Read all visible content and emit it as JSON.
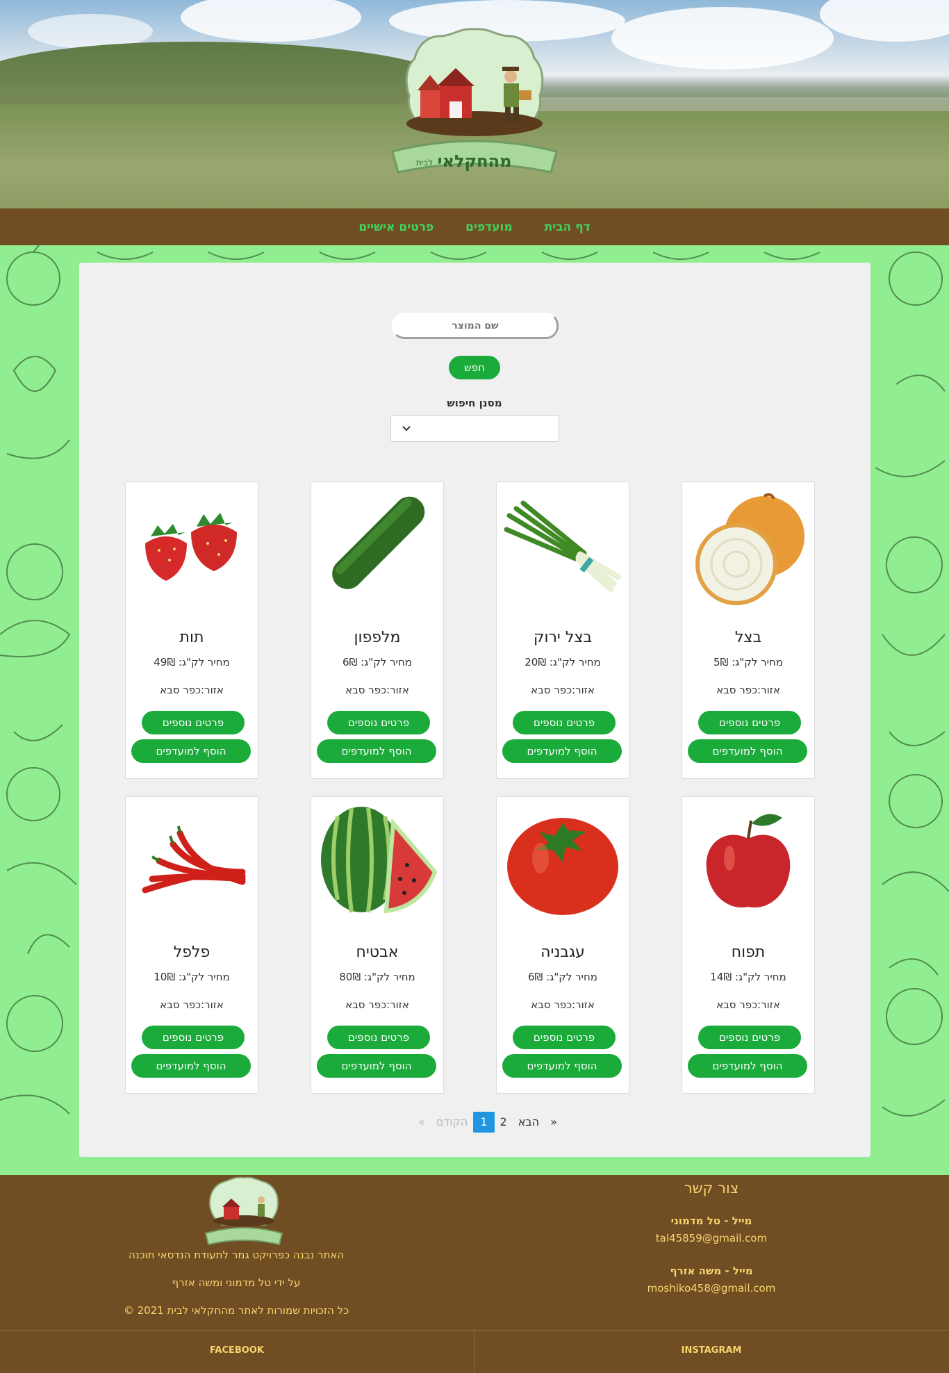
{
  "nav": {
    "home": "דף הבית",
    "favorites": "מועדפים",
    "personal": "פרטים אישיים"
  },
  "logo": {
    "text_main": "מהחקלאי",
    "text_small": "לבית"
  },
  "search": {
    "placeholder": "שם המוצר",
    "button": "חפש",
    "filter_label": "מסנן חיפוש",
    "filter_value": ""
  },
  "products": [
    {
      "name": "בצל",
      "price": "מחיר לק\"ג: 5₪",
      "area": "אזור:כפר סבא",
      "more": "פרטים נוספים",
      "fav": "הוסף למועדפים",
      "icon": "onion-image"
    },
    {
      "name": "בצל ירוק",
      "price": "מחיר לק\"ג: 20₪",
      "area": "אזור:כפר סבא",
      "more": "פרטים נוספים",
      "fav": "הוסף למועדפים",
      "icon": "green-onion-image"
    },
    {
      "name": "מלפפון",
      "price": "מחיר לק\"ג: 6₪",
      "area": "אזור:כפר סבא",
      "more": "פרטים נוספים",
      "fav": "הוסף למועדפים",
      "icon": "cucumber-image"
    },
    {
      "name": "תות",
      "price": "מחיר לק\"ג: 49₪",
      "area": "אזור:כפר סבא",
      "more": "פרטים נוספים",
      "fav": "הוסף למועדפים",
      "icon": "strawberry-image"
    },
    {
      "name": "תפוח",
      "price": "מחיר לק\"ג: 14₪",
      "area": "אזור:כפר סבא",
      "more": "פרטים נוספים",
      "fav": "הוסף למועדפים",
      "icon": "apple-image"
    },
    {
      "name": "עגבניה",
      "price": "מחיר לק\"ג: 6₪",
      "area": "אזור:כפר סבא",
      "more": "פרטים נוספים",
      "fav": "הוסף למועדפים",
      "icon": "tomato-image"
    },
    {
      "name": "אבטיח",
      "price": "מחיר לק\"ג: 80₪",
      "area": "אזור:כפר סבא",
      "more": "פרטים נוספים",
      "fav": "הוסף למועדפים",
      "icon": "watermelon-image"
    },
    {
      "name": "פלפל",
      "price": "מחיר לק\"ג: 10₪",
      "area": "אזור:כפר סבא",
      "more": "פרטים נוספים",
      "fav": "הוסף למועדפים",
      "icon": "chili-pepper-image"
    }
  ],
  "pagination": {
    "first": "«",
    "next": "הבא",
    "page2": "2",
    "page1": "1",
    "prev": "הקודם",
    "last": "»",
    "current_page": 1
  },
  "footer": {
    "contact_title": "צור קשר",
    "contact1_label": "מייל - טל מדמוני",
    "contact1_email": "tal45859@gmail.com",
    "contact2_label": "מייל - משה אזרף",
    "contact2_email": "moshiko458@gmail.com",
    "about_line1": "האתר נבנה כפרויקט גמר לתעודת הנדסאי תוכנה",
    "about_line2": "על ידי טל מדמוני ומשה אזרף",
    "copyright": "כל הזכויות שמורות לאתר מהחקלאי לבית  2021  ©",
    "instagram": "INSTAGRAM",
    "facebook": "FACEBOOK"
  },
  "colors": {
    "nav_bg": "#714d24",
    "nav_link": "#3fd35a",
    "pattern_bg": "#90ee90",
    "button_green": "#1aab3a",
    "footer_text": "#f5d76e",
    "pager_active": "#2196e0"
  }
}
